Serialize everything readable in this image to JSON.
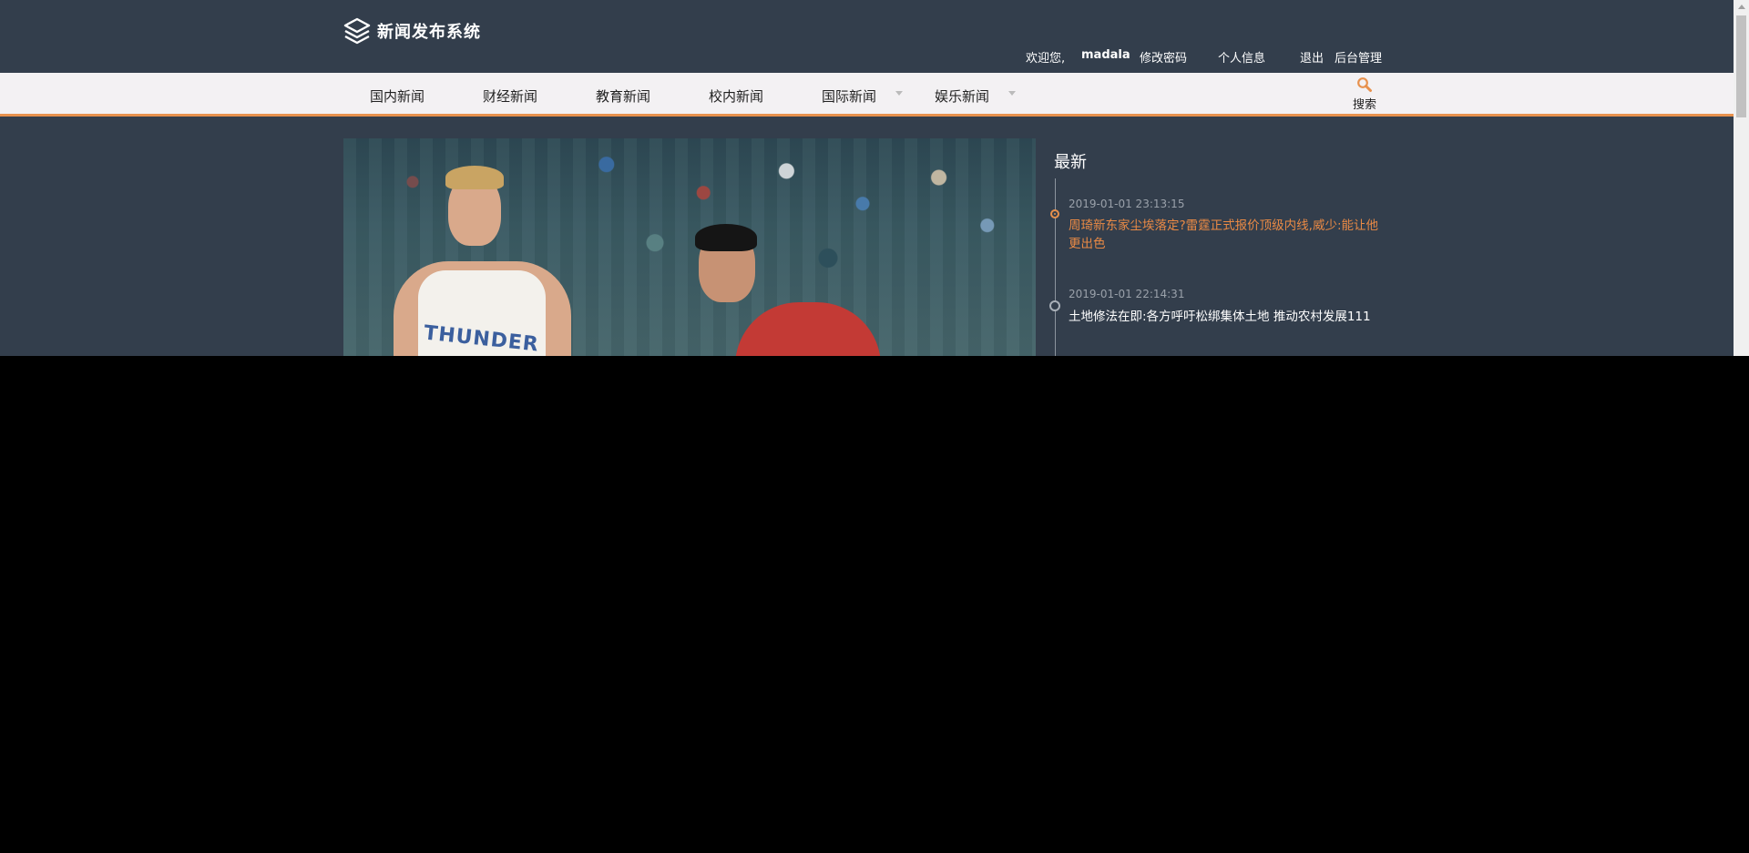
{
  "header": {
    "logo_text": "新闻发布系统",
    "welcome": "欢迎您,",
    "username": "madala",
    "change_password": "修改密码",
    "profile": "个人信息",
    "logout": "退出",
    "admin": "后台管理"
  },
  "nav": {
    "items": [
      {
        "label": "国内新闻"
      },
      {
        "label": "财经新闻"
      },
      {
        "label": "教育新闻"
      },
      {
        "label": "校内新闻"
      },
      {
        "label": "国际新闻"
      },
      {
        "label": "娱乐新闻"
      }
    ],
    "search_label": "搜索"
  },
  "hero": {
    "jersey_text": "THUNDER"
  },
  "sidebar": {
    "title": "最新",
    "news": [
      {
        "time": "2019-01-01 23:13:15",
        "title": "周琦新东家尘埃落定?雷霆正式报价顶级内线,威少:能让他更出色"
      },
      {
        "time": "2019-01-01 22:14:31",
        "title": "土地修法在即:各方呼吁松绑集体土地 推动农村发展111"
      }
    ]
  },
  "colors": {
    "background": "#333e4c",
    "accent": "#e7914d",
    "nav_bg": "#f3f1f3"
  }
}
